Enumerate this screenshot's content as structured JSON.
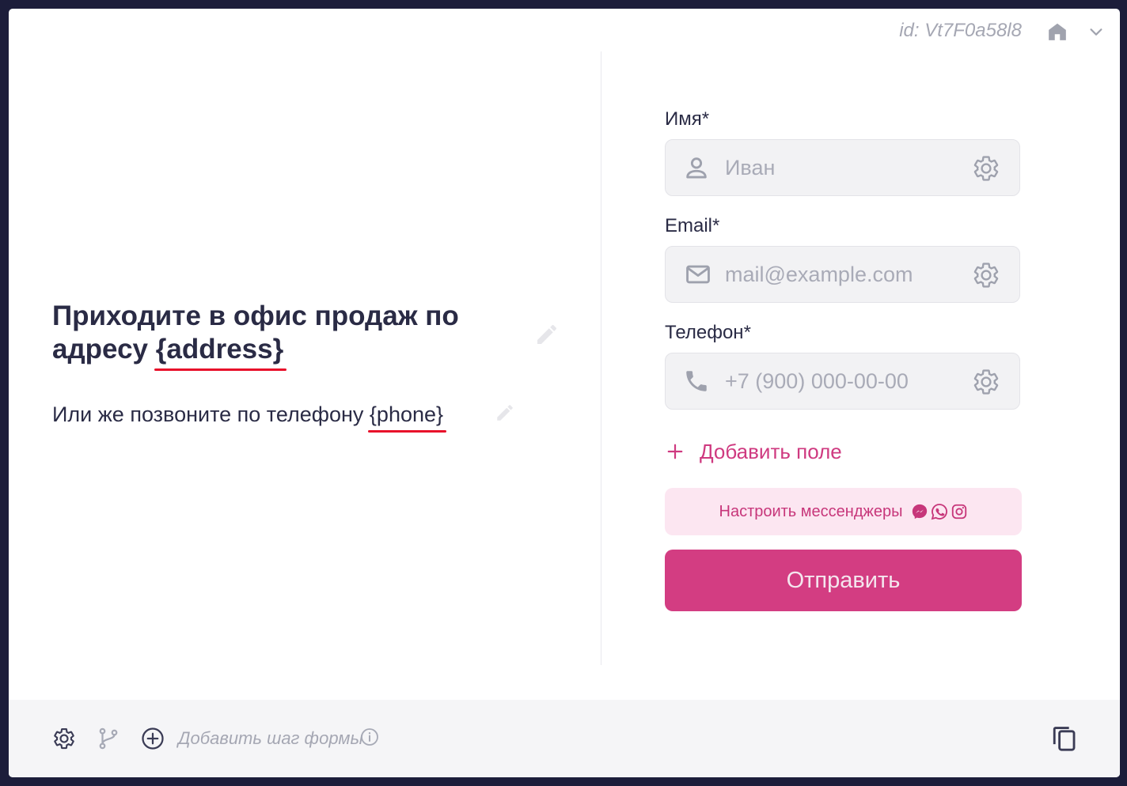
{
  "header": {
    "widget_id": "id: Vt7F0a58l8",
    "home_icon": "home-icon",
    "collapse_icon": "chevron-down-icon"
  },
  "content": {
    "headline_text": "Приходите в офис продаж по адресу ",
    "headline_token": "{address}",
    "sub_text": "Или же позвоните по телефону ",
    "sub_token": "{phone}",
    "edit_icon": "pencil-icon",
    "token_underline_color": "#e8102a"
  },
  "form": {
    "fields": [
      {
        "label": "Имя*",
        "placeholder": "Иван",
        "icon": "user-icon",
        "settings_icon": "gear-icon"
      },
      {
        "label": "Email*",
        "placeholder": "mail@example.com",
        "icon": "mail-icon",
        "settings_icon": "gear-icon"
      },
      {
        "label": "Телефон*",
        "placeholder": "+7 (900) 000-00-00",
        "icon": "phone-icon",
        "settings_icon": "gear-icon"
      }
    ],
    "add_field_label": "Добавить поле",
    "messengers_label": "Настроить мессенджеры",
    "messenger_icons": [
      "messenger-icon",
      "whatsapp-icon",
      "instagram-icon"
    ],
    "submit_label": "Отправить",
    "accent_color": "#d33d82",
    "messengers_bg": "#fce6f1"
  },
  "footer": {
    "add_step_label": "Добавить шаг формы",
    "icons": [
      "gear-icon",
      "branch-icon",
      "plus-circle-icon",
      "info-icon",
      "copy-icon"
    ]
  }
}
